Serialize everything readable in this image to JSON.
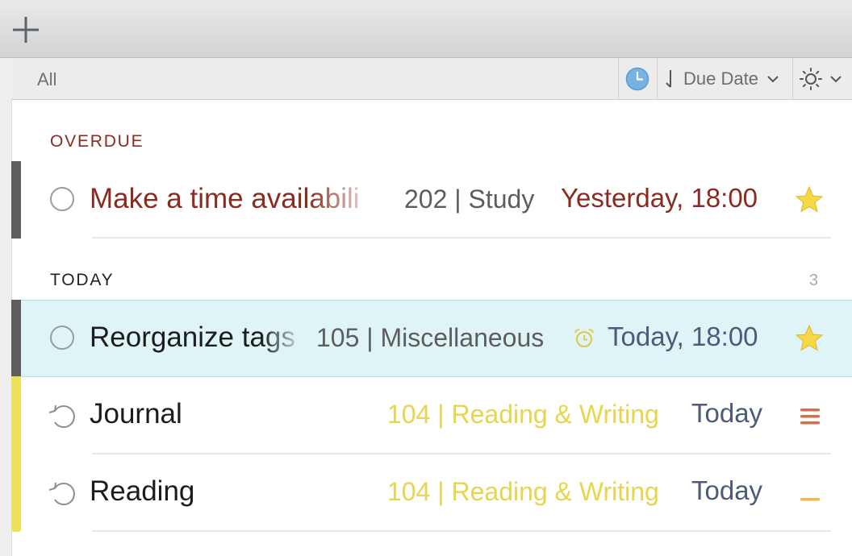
{
  "colors": {
    "overdue_red": "#8a2a20",
    "due_blue": "#4c5b7c",
    "list_gray": "#5d5d5d",
    "list_yellow": "#e6d54d",
    "star_yellow": "#f6d845",
    "selected_bg": "#dff4f7",
    "indicator_gray": "#5e5e5e",
    "indicator_yellow": "#eee15a",
    "priority_high": "#d4714d",
    "priority_medium": "#f0b84e"
  },
  "toolbar": {
    "add_icon": "plus-icon"
  },
  "filter_bar": {
    "label": "All",
    "clock_icon": "clock-icon",
    "sort_arrow_icon": "sort-arrow-icon",
    "sort_label": "Due Date",
    "sort_chevron": "chevron-down-icon",
    "display_icon": "sun-icon",
    "display_chevron": "chevron-down-icon"
  },
  "sections": [
    {
      "title": "OVERDUE",
      "count": "",
      "tasks": [
        {
          "title": "Make a time availabili",
          "list": "202 | Study",
          "due": "Yesterday, 18:00",
          "icon": "star-icon",
          "starred": true,
          "indicator": "gray"
        }
      ]
    },
    {
      "title": "TODAY",
      "count": "3",
      "tasks": [
        {
          "title": "Reorganize tags",
          "list": "105 | Miscellaneous",
          "due": "Today, 18:00",
          "reminder_icon": "alarm-clock-icon",
          "icon": "star-icon",
          "starred": true,
          "selected": true,
          "indicator": "gray"
        },
        {
          "title": "Journal",
          "list": "104 | Reading & Writing",
          "due": "Today",
          "repeat_icon": "repeat-icon",
          "icon": "priority-high-icon",
          "indicator": "yellow"
        },
        {
          "title": "Reading",
          "list": "104 | Reading & Writing",
          "due": "Today",
          "repeat_icon": "repeat-icon",
          "icon": "priority-medium-icon",
          "indicator": "yellow"
        }
      ]
    }
  ]
}
